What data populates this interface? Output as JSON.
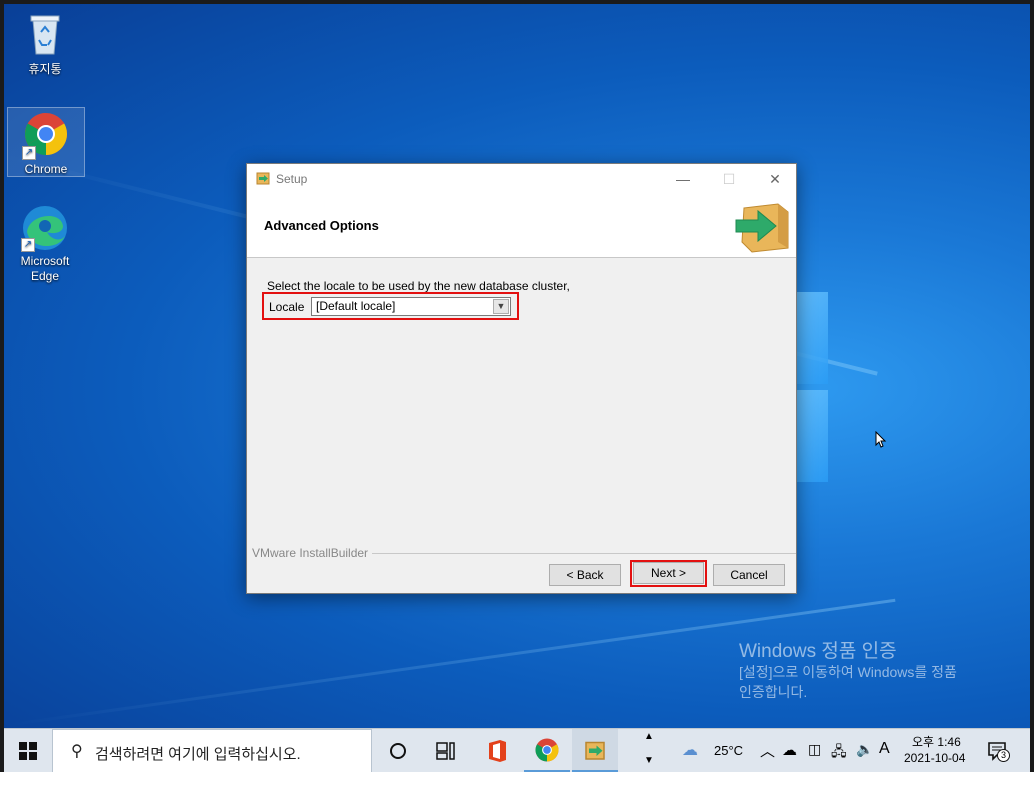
{
  "desktop": {
    "icons": [
      {
        "label": "휴지통"
      },
      {
        "label": "Chrome"
      },
      {
        "label": "Microsoft Edge"
      }
    ],
    "watermark": {
      "line1": "Windows 정품 인증",
      "line2": "[설정]으로 이동하여 Windows를 정품",
      "line3": "인증합니다."
    }
  },
  "dialog": {
    "title": "Setup",
    "header_title": "Advanced Options",
    "description": "Select the locale to be used by the new database cluster,",
    "locale_label": "Locale",
    "locale_value": "[Default locale]",
    "brand": "VMware InstallBuilder",
    "back_label": "< Back",
    "next_label": "Next >",
    "cancel_label": "Cancel"
  },
  "taskbar": {
    "search_placeholder": "검색하려면 여기에 입력하십시오.",
    "weather_temp": "25°C",
    "ime": "A",
    "time_period": "오후 1:46",
    "date": "2021-10-04",
    "notification_count": "3"
  },
  "icons": [
    "recycle-bin-icon",
    "chrome-icon",
    "edge-icon",
    "windows-start-icon",
    "search-icon",
    "task-view-icon",
    "office-icon",
    "installer-icon"
  ],
  "colors": {
    "highlight": "#e31010",
    "desktop": "#0c5cbc"
  }
}
